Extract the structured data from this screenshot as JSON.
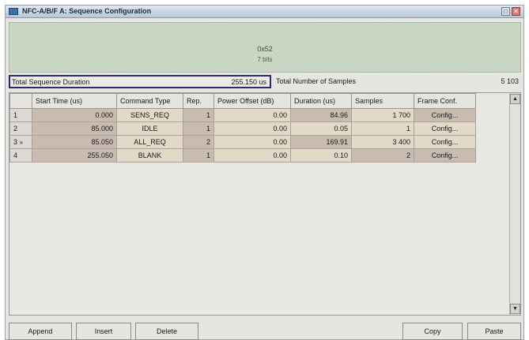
{
  "window": {
    "title": "NFC-A/B/F A: Sequence Configuration",
    "max_glyph": "□",
    "close_glyph": "✕"
  },
  "preview": {
    "hex": "0x52",
    "bits": "7 bits"
  },
  "summary": {
    "duration_label": "Total Sequence Duration",
    "duration_value": "255.150 us",
    "samples_label": "Total Number of Samples",
    "samples_value": "5 103"
  },
  "table": {
    "headers": [
      "",
      "Start Time (us)",
      "Command Type",
      "Rep.",
      "Power Offset (dB)",
      "Duration (us)",
      "Samples",
      "Frame Conf."
    ],
    "rows": [
      {
        "num": "1",
        "marker": "",
        "start": "0.000",
        "command": "SENS_REQ",
        "rep": "1",
        "power": "0.00",
        "duration": "84.96",
        "samples": "1 700",
        "frame": "Config..."
      },
      {
        "num": "2",
        "marker": "",
        "start": "85.000",
        "command": "IDLE",
        "rep": "1",
        "power": "0.00",
        "duration": "0.05",
        "samples": "1",
        "frame": "Config..."
      },
      {
        "num": "3",
        "marker": "»",
        "start": "85.050",
        "command": "ALL_REQ",
        "rep": "2",
        "power": "0.00",
        "duration": "169.91",
        "samples": "3 400",
        "frame": "Config..."
      },
      {
        "num": "4",
        "marker": "",
        "start": "255.050",
        "command": "BLANK",
        "rep": "1",
        "power": "0.00",
        "duration": "0.10",
        "samples": "2",
        "frame": "Config..."
      }
    ]
  },
  "scroll": {
    "up": "▲",
    "down": "▼"
  },
  "buttons": {
    "append": "Append",
    "insert": "Insert",
    "delete": "Delete",
    "copy": "Copy",
    "paste": "Paste"
  }
}
